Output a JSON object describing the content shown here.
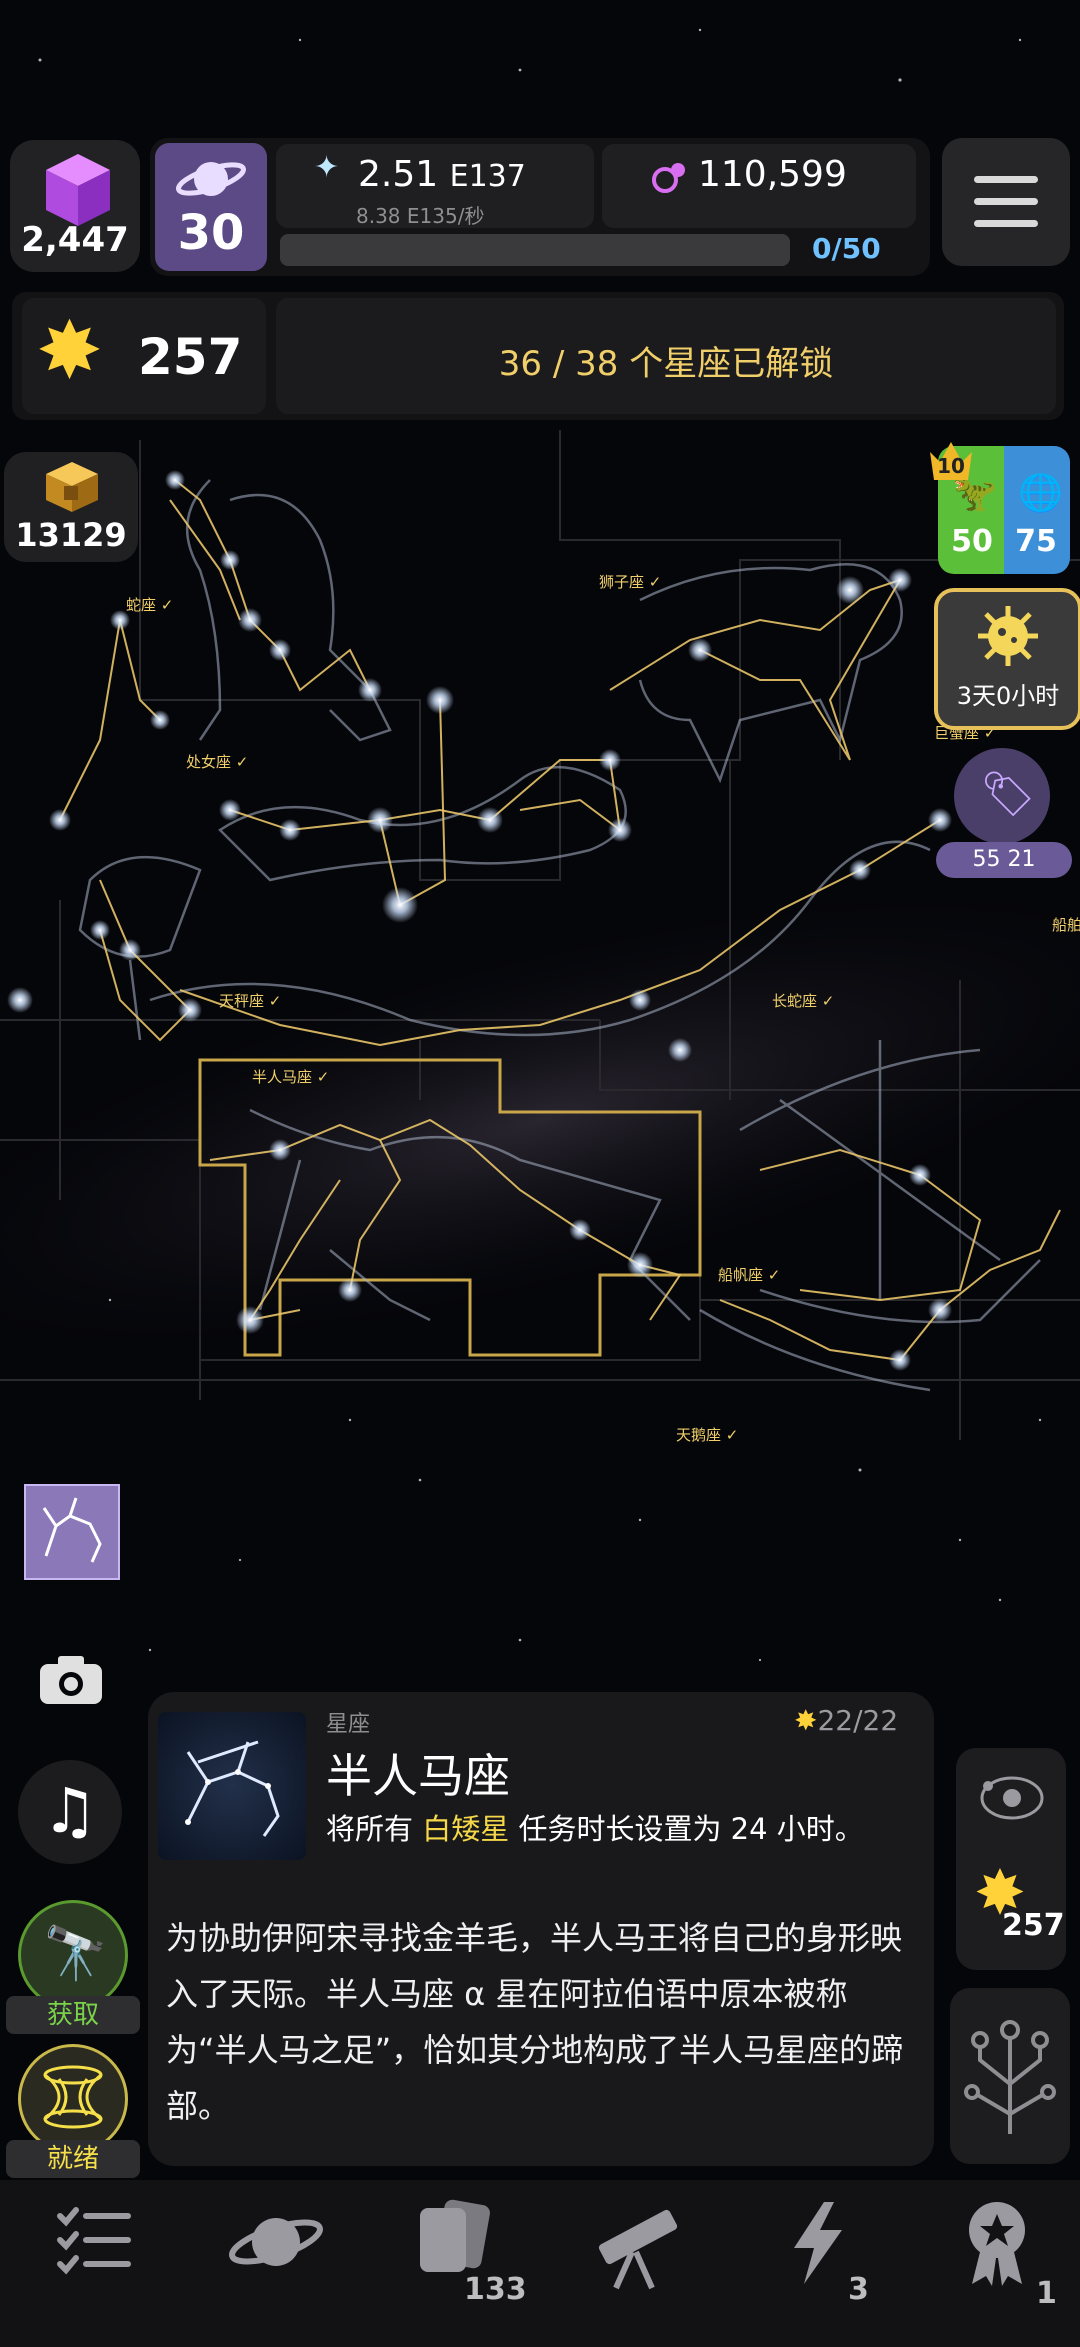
{
  "resources": {
    "gems": "2,447",
    "planet_level": "30",
    "stardust": "2.51",
    "stardust_exp": "E137",
    "stardust_rate": "8.38 E135/秒",
    "particles": "110,599",
    "progress_text": "0/50",
    "progress_fraction": 0.0
  },
  "stars": {
    "count": "257",
    "unlock_status": "36 / 38 个星座已解锁"
  },
  "cubes": {
    "count": "13129"
  },
  "side_badge": {
    "crown_level": "10",
    "green": "50",
    "blue": "75"
  },
  "virus_timer": "3天0小时",
  "tag_timer": "55 21",
  "constellations": {
    "serpens": "蛇座",
    "virgo": "处女座",
    "leo": "狮子座",
    "cancer": "巨蟹座",
    "libra": "天秤座",
    "hydra": "长蛇座",
    "centaurus": "半人马座",
    "vela": "船帆座",
    "cygnus": "天鹅座",
    "carina": "船舶"
  },
  "card": {
    "category": "星座",
    "title": "半人马座",
    "star_progress": "22/22",
    "effect_prefix": "将所有",
    "effect_highlight": "白矮星",
    "effect_suffix": "任务时长设置为 24 小时。",
    "lore": "为协助伊阿宋寻找金羊毛，半人马王将自己的身形映入了天际。半人马座 α 星在阿拉伯语中原本被称为“半人马之足”，恰如其分地构成了半人马星座的蹄部。"
  },
  "right_panel": {
    "stars": "257"
  },
  "left_buttons": {
    "acquire": "获取",
    "ready": "就绪"
  },
  "nav": {
    "cards_badge": "133",
    "energy_badge": "3",
    "achievements_badge": "1"
  },
  "colors": {
    "gold": "#f0cf6a",
    "accent_purple": "#5b4a86",
    "highlight_yellow": "#f5d84a",
    "green": "#7bd34a"
  }
}
